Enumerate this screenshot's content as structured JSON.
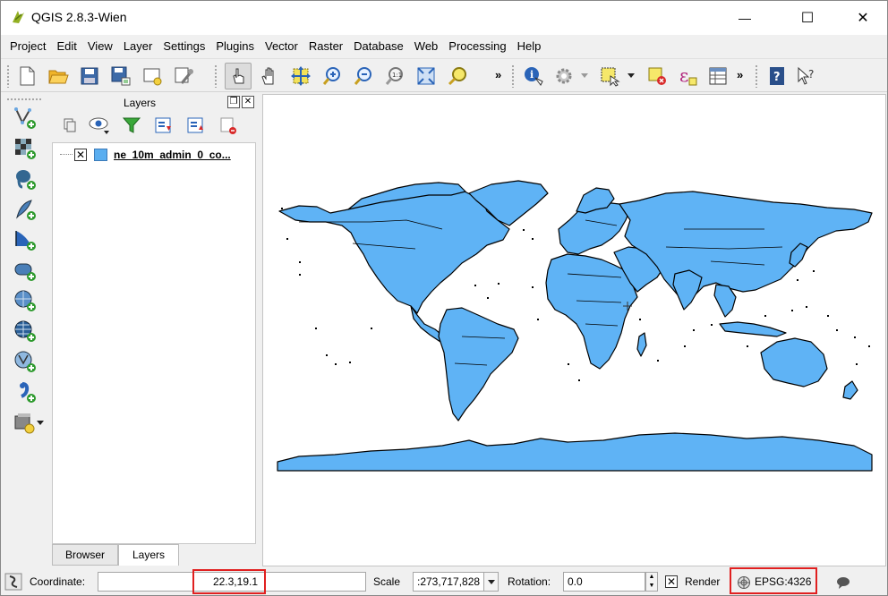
{
  "window": {
    "title": "QGIS 2.8.3-Wien",
    "minimize_glyph": "—",
    "maximize_glyph": "☐",
    "close_glyph": "✕"
  },
  "menu": {
    "items": [
      "Project",
      "Edit",
      "View",
      "Layer",
      "Settings",
      "Plugins",
      "Vector",
      "Raster",
      "Database",
      "Web",
      "Processing",
      "Help"
    ]
  },
  "toolbar": {
    "overflow_1": "»",
    "overflow_2": "»"
  },
  "layers_panel": {
    "title": "Layers",
    "float_glyph": "❐",
    "close_glyph": "✕",
    "layer": {
      "name": "ne_10m_admin_0_co...",
      "checked_glyph": "✕",
      "color": "#5aaef0"
    },
    "tabs": [
      "Browser",
      "Layers"
    ],
    "active_tab": "Layers"
  },
  "map": {
    "land_color": "#5fb3f5",
    "border_color": "#000000"
  },
  "statusbar": {
    "coordinate_label": "Coordinate:",
    "coordinate_value": "22.3,19.1",
    "scale_label": "Scale",
    "scale_value": ":273,717,828",
    "rotation_label": "Rotation:",
    "rotation_value": "0.0",
    "render_label": "Render",
    "render_checked_glyph": "✕",
    "crs_label": "EPSG:4326",
    "highlight_color": "#e02020"
  }
}
